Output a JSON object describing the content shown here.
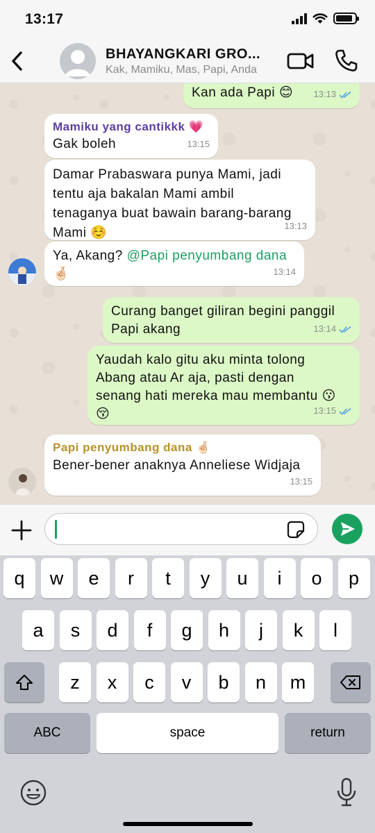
{
  "status": {
    "time": "13:17",
    "battery_level": 0.9
  },
  "header": {
    "title": "BHAYANGKARI GRO...",
    "subtitle": "Kak, Mamiku, Mas, Papi, Anda",
    "back_icon": "chevron-left-icon",
    "video_icon": "video-camera-icon",
    "call_icon": "phone-icon"
  },
  "messages": [
    {
      "dir": "out",
      "text": "Kan ada Papi 😊",
      "time": "13:13",
      "read": true
    },
    {
      "dir": "in",
      "sender": "Mamiku yang cantikkk 💗",
      "sender_color": "#5b3fa0",
      "text": "Gak boleh",
      "time": "13:15"
    },
    {
      "dir": "in",
      "text_lines": [
        "Damar Prabaswara punya Mami, jadi",
        "tentu aja bakalan Mami ambil",
        "tenaganya buat bawain barang-barang",
        "Mami ☺️"
      ],
      "time": "13:13"
    },
    {
      "dir": "in",
      "text": "Ya, Akang? ",
      "mention": "@Papi penyumbang dana",
      "text_after": "🤞🏻",
      "time": "13:14"
    },
    {
      "dir": "out",
      "text_lines": [
        "Curang banget giliran begini panggil",
        "Papi akang"
      ],
      "time": "13:14",
      "read": true
    },
    {
      "dir": "out",
      "text_lines": [
        "Yaudah kalo gitu aku minta tolong",
        "Abang atau Ar aja, pasti dengan",
        "senang hati mereka mau membantu 😗",
        "😚"
      ],
      "time": "13:15",
      "read": true
    },
    {
      "dir": "in",
      "sender": "Papi penyumbang dana 🤞🏻",
      "sender_color": "#b8922a",
      "text": "Bener-bener anaknya Anneliese Widjaja",
      "time": "13:15"
    }
  ],
  "composer": {
    "value": "",
    "plus_icon": "plus-icon",
    "sticker_icon": "sticker-icon",
    "send_icon": "send-icon"
  },
  "keyboard": {
    "row1": [
      "q",
      "w",
      "e",
      "r",
      "t",
      "y",
      "u",
      "i",
      "o",
      "p"
    ],
    "row2": [
      "a",
      "s",
      "d",
      "f",
      "g",
      "h",
      "j",
      "k",
      "l"
    ],
    "row3": [
      "z",
      "x",
      "c",
      "v",
      "b",
      "n",
      "m"
    ],
    "abc": "ABC",
    "space": "space",
    "return": "return",
    "shift_icon": "shift-icon",
    "delete_icon": "backspace-icon",
    "emoji_icon": "emoji-icon",
    "mic_icon": "microphone-icon"
  },
  "colors": {
    "outgoing": "#dcf8c6",
    "incoming": "#ffffff",
    "accent": "#1aa160",
    "read_ticks": "#4fa3e0"
  }
}
